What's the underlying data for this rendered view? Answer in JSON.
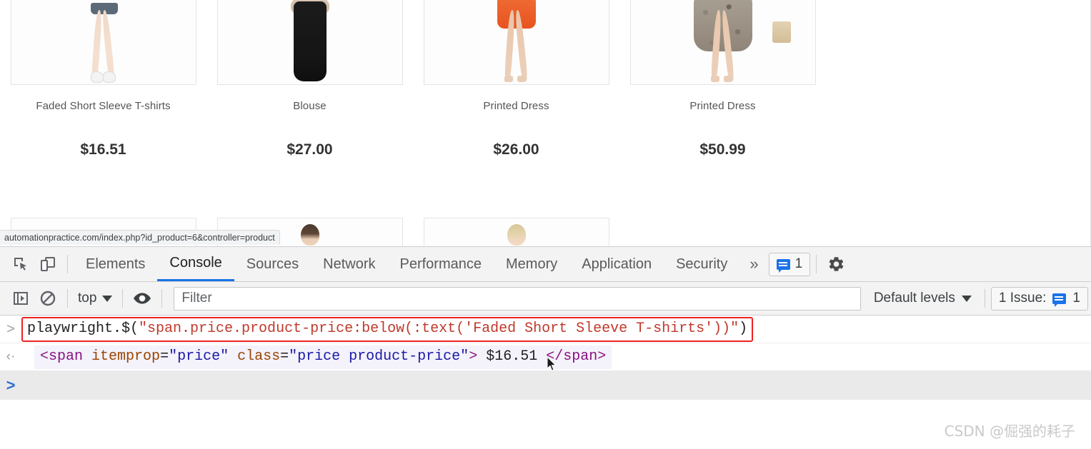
{
  "page": {
    "status_url": "automationpractice.com/index.php?id_product=6&controller=product",
    "products_row1": [
      {
        "title": "Faded Short Sleeve T-shirts",
        "price": "$16.51"
      },
      {
        "title": "Blouse",
        "price": "$27.00"
      },
      {
        "title": "Printed Dress",
        "price": "$26.00"
      },
      {
        "title": "Printed Dress",
        "price": "$50.99"
      }
    ]
  },
  "devtools": {
    "tabs": [
      {
        "label": "Elements",
        "active": false
      },
      {
        "label": "Console",
        "active": true
      },
      {
        "label": "Sources",
        "active": false
      },
      {
        "label": "Network",
        "active": false
      },
      {
        "label": "Performance",
        "active": false
      },
      {
        "label": "Memory",
        "active": false
      },
      {
        "label": "Application",
        "active": false
      },
      {
        "label": "Security",
        "active": false
      }
    ],
    "more_tabs_label": "»",
    "issues_pill_count": "1",
    "icons": {
      "inspect": "inspect-element-icon",
      "device": "device-toolbar-icon",
      "settings": "gear-icon",
      "sidebar": "console-sidebar-icon",
      "clear": "clear-console-icon",
      "eye": "live-expression-icon",
      "message": "message-icon"
    },
    "filterbar": {
      "context": "top",
      "filter_placeholder": "Filter",
      "filter_value": "",
      "levels": "Default levels",
      "issues_label": "1 Issue:",
      "issues_count": "1"
    },
    "console": {
      "input_prompt": ">",
      "input_command": "playwright.$(\"span.price.product-price:below(:text('Faded Short Sleeve T-shirts'))\")",
      "output_prompt": "‹·",
      "output_tokens": [
        {
          "t": "<",
          "c": "tok-punct"
        },
        {
          "t": "span",
          "c": "tok-tag"
        },
        {
          "t": " ",
          "c": "tok-plain"
        },
        {
          "t": "itemprop",
          "c": "tok-attr"
        },
        {
          "t": "=",
          "c": "tok-plain"
        },
        {
          "t": "\"price\"",
          "c": "tok-val"
        },
        {
          "t": " ",
          "c": "tok-plain"
        },
        {
          "t": "class",
          "c": "tok-attr"
        },
        {
          "t": "=",
          "c": "tok-plain"
        },
        {
          "t": "\"price product-price\"",
          "c": "tok-val"
        },
        {
          "t": ">",
          "c": "tok-punct"
        },
        {
          "t": " $16.51 ",
          "c": "tok-text"
        },
        {
          "t": "</span>",
          "c": "tok-punct"
        }
      ],
      "next_prompt": ">"
    }
  },
  "watermark": "CSDN @倔强的耗子",
  "colors": {
    "accent_blue": "#1a73e8",
    "annotation_red": "#ee2222",
    "toolbar_bg": "#f3f3f3",
    "prompt_bg": "#eaeaea"
  }
}
